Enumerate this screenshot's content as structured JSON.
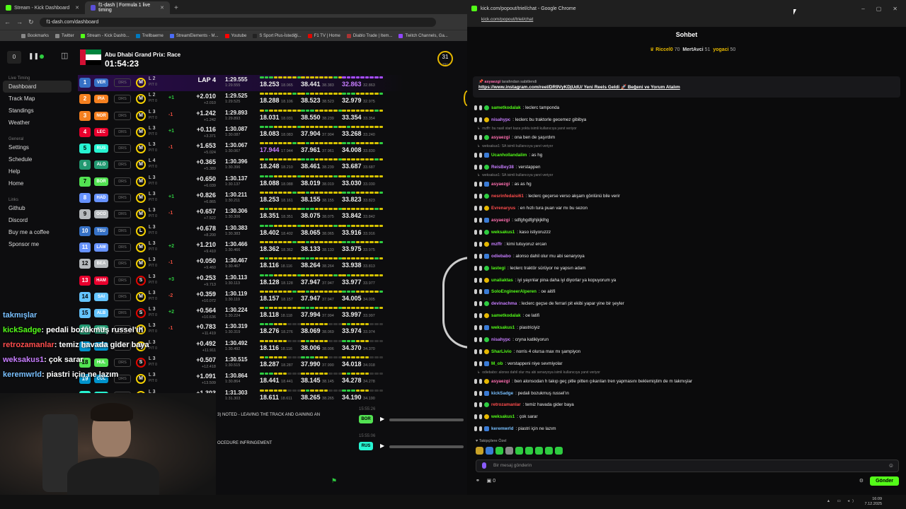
{
  "browser": {
    "tabs": [
      {
        "label": "Stream - Kick Dashboard"
      },
      {
        "label": "f1-dash | Formula 1 live timing"
      }
    ],
    "url": "f1-dash.com/dashboard",
    "bookmarks": [
      "Bookmarks",
      "Twitter",
      "Stream - Kick Dashb...",
      "Trellbaerne",
      "StreamElements - M...",
      "Youtube",
      "S Sport Plus-İstediği...",
      "F1 TV | Home",
      "Diablo Trade | Item...",
      "Twitch Channels, Ga..."
    ]
  },
  "dashboard": {
    "counter": "0",
    "race_title": "Abu Dhabi Grand Prix: Race",
    "race_clock": "01:54:23",
    "temp_value": "31",
    "temp_label": "TRC",
    "sidebar": {
      "section1": "Live Timing",
      "items1": [
        "Dashboard",
        "Track Map",
        "Standings",
        "Weather"
      ],
      "section2": "General",
      "items2": [
        "Settings",
        "Schedule",
        "Help",
        "Home"
      ],
      "section3": "Links",
      "items3": [
        "Github",
        "Discord",
        "Buy me a coffee",
        "Sponsor me"
      ]
    },
    "drs_label": "DRS",
    "rows": [
      {
        "pos": "1",
        "code": "VER",
        "color": "#3671c6",
        "tyre": "M",
        "lap": "L 2",
        "pit": "PIT 0",
        "chg": "",
        "gap": "LAP 4",
        "gap_sub": "",
        "last": "1:29.555",
        "last_sub": "1:29.555",
        "s1": "18.253",
        "s1s": "18.065",
        "s2": "38.441",
        "s2s": "38.383",
        "s3": "32.863",
        "s3s": "32.863"
      },
      {
        "pos": "2",
        "code": "PIA",
        "color": "#f58020",
        "tyre": "M",
        "lap": "L 2",
        "pit": "PIT 0",
        "chg": "+1",
        "gap": "+2.010",
        "gap_sub": "+2.010",
        "last": "1:29.525",
        "last_sub": "1:29.525",
        "s1": "18.288",
        "s1s": "18.106",
        "s2": "38.523",
        "s2s": "38.523",
        "s3": "32.979",
        "s3s": "32.975"
      },
      {
        "pos": "3",
        "code": "NOR",
        "color": "#f58020",
        "tyre": "M",
        "lap": "L 3",
        "pit": "PIT 0",
        "chg": "-1",
        "gap": "+1.242",
        "gap_sub": "+1.242",
        "last": "1:29.893",
        "last_sub": "1:29.893",
        "s1": "18.031",
        "s1s": "18.031",
        "s2": "38.550",
        "s2s": "38.239",
        "s3": "33.354",
        "s3s": "33.354"
      },
      {
        "pos": "4",
        "code": "LEC",
        "color": "#e8002d",
        "tyre": "M",
        "lap": "L 3",
        "pit": "PIT 0",
        "chg": "+1",
        "gap": "+0.116",
        "gap_sub": "+3.371",
        "last": "1:30.087",
        "last_sub": "1:30.087",
        "s1": "18.083",
        "s1s": "18.083",
        "s2": "37.904",
        "s2s": "37.904",
        "s3": "33.268",
        "s3s": "33.240"
      },
      {
        "pos": "5",
        "code": "RUS",
        "color": "#27f4d2",
        "tyre": "M",
        "lap": "L 3",
        "pit": "PIT 0",
        "chg": "-1",
        "gap": "+1.653",
        "gap_sub": "+5.024",
        "last": "1:30.067",
        "last_sub": "1:30.067",
        "s1": "17.944",
        "s1s": "17.944",
        "s2": "37.961",
        "s2s": "37.961",
        "s3": "34.008",
        "s3s": "33.830"
      },
      {
        "pos": "6",
        "code": "ALO",
        "color": "#229971",
        "tyre": "M",
        "lap": "L 4",
        "pit": "PIT 0",
        "chg": "",
        "gap": "+0.365",
        "gap_sub": "+5.389",
        "last": "1:30.396",
        "last_sub": "1:30.396",
        "s1": "18.248",
        "s1s": "18.210",
        "s2": "38.461",
        "s2s": "38.239",
        "s3": "33.687",
        "s3s": "33.687"
      },
      {
        "pos": "7",
        "code": "BOR",
        "color": "#52e252",
        "tyre": "M",
        "lap": "L 3",
        "pit": "PIT 0",
        "chg": "",
        "gap": "+0.650",
        "gap_sub": "+6.039",
        "last": "1:30.137",
        "last_sub": "1:30.137",
        "s1": "18.088",
        "s1s": "18.088",
        "s2": "38.019",
        "s2s": "38.019",
        "s3": "33.030",
        "s3s": "33.030"
      },
      {
        "pos": "8",
        "code": "HAD",
        "color": "#6692ff",
        "tyre": "M",
        "lap": "L 3",
        "pit": "PIT 0",
        "chg": "+1",
        "gap": "+0.826",
        "gap_sub": "+6.865",
        "last": "1:30.211",
        "last_sub": "1:30.211",
        "s1": "18.253",
        "s1s": "18.161",
        "s2": "38.155",
        "s2s": "38.155",
        "s3": "33.823",
        "s3s": "33.823"
      },
      {
        "pos": "9",
        "code": "OCO",
        "color": "#b6babd",
        "tyre": "M",
        "lap": "L 3",
        "pit": "PIT 0",
        "chg": "-1",
        "gap": "+0.657",
        "gap_sub": "+7.522",
        "last": "1:30.306",
        "last_sub": "1:30.306",
        "s1": "18.351",
        "s1s": "18.351",
        "s2": "38.075",
        "s2s": "38.075",
        "s3": "33.842",
        "s3s": "33.842"
      },
      {
        "pos": "10",
        "code": "TSU",
        "color": "#3671c6",
        "tyre": "L",
        "lap": "L 3",
        "pit": "PIT 0",
        "chg": "",
        "gap": "+0.678",
        "gap_sub": "+8.200",
        "last": "1:30.383",
        "last_sub": "1:30.383",
        "s1": "18.402",
        "s1s": "18.402",
        "s2": "38.065",
        "s2s": "38.065",
        "s3": "33.916",
        "s3s": "33.916"
      },
      {
        "pos": "11",
        "code": "LAW",
        "color": "#6692ff",
        "tyre": "M",
        "lap": "L 3",
        "pit": "PIT 0",
        "chg": "+2",
        "gap": "+1.210",
        "gap_sub": "+9.410",
        "last": "1:30.466",
        "last_sub": "1:30.466",
        "s1": "18.362",
        "s1s": "18.362",
        "s2": "38.133",
        "s2s": "38.133",
        "s3": "33.975",
        "s3s": "33.975"
      },
      {
        "pos": "12",
        "code": "BEA",
        "color": "#b6babd",
        "tyre": "M",
        "lap": "L 3",
        "pit": "PIT 0",
        "chg": "-1",
        "gap": "+0.050",
        "gap_sub": "+9.460",
        "last": "1:30.467",
        "last_sub": "1:30.467",
        "s1": "18.116",
        "s1s": "18.116",
        "s2": "38.264",
        "s2s": "38.264",
        "s3": "33.938",
        "s3s": "33.813"
      },
      {
        "pos": "13",
        "code": "HAM",
        "color": "#e8002d",
        "tyre": "S",
        "lap": "L 3",
        "pit": "PIT 0",
        "chg": "+3",
        "gap": "+0.253",
        "gap_sub": "+9.713",
        "last": "1:30.113",
        "last_sub": "1:30.113",
        "s1": "18.128",
        "s1s": "18.128",
        "s2": "37.947",
        "s2s": "37.947",
        "s3": "33.977",
        "s3s": "33.977"
      },
      {
        "pos": "14",
        "code": "SAI",
        "color": "#64c4ff",
        "tyre": "M",
        "lap": "L 3",
        "pit": "PIT 0",
        "chg": "-2",
        "gap": "+0.359",
        "gap_sub": "+10.072",
        "last": "1:30.119",
        "last_sub": "1:30.119",
        "s1": "18.157",
        "s1s": "18.157",
        "s2": "37.947",
        "s2s": "37.947",
        "s3": "34.005",
        "s3s": "34.005"
      },
      {
        "pos": "15",
        "code": "ALB",
        "color": "#64c4ff",
        "tyre": "S",
        "lap": "L 3",
        "pit": "PIT 0",
        "chg": "+2",
        "gap": "+0.564",
        "gap_sub": "+10.636",
        "last": "1:30.224",
        "last_sub": "1:30.224",
        "s1": "18.118",
        "s1s": "18.118",
        "s2": "37.994",
        "s2s": "37.994",
        "s3": "33.997",
        "s3s": "33.997"
      },
      {
        "pos": "16",
        "code": "STR",
        "color": "#229971",
        "tyre": "M",
        "lap": "L 3",
        "pit": "PIT 0",
        "chg": "-1",
        "gap": "+0.783",
        "gap_sub": "+11.419",
        "last": "1:30.319",
        "last_sub": "1:30.319",
        "s1": "18.276",
        "s1s": "18.276",
        "s2": "38.069",
        "s2s": "38.069",
        "s3": "33.974",
        "s3s": "33.974"
      },
      {
        "pos": "17",
        "code": "GAS",
        "color": "#0093cc",
        "tyre": "M",
        "lap": "L 3",
        "pit": "PIT 0",
        "chg": "",
        "gap": "+0.492",
        "gap_sub": "+11.911",
        "last": "1:30.492",
        "last_sub": "1:30.492",
        "s1": "18.116",
        "s1s": "18.116",
        "s2": "38.006",
        "s2s": "38.006",
        "s3": "34.370",
        "s3s": "34.370"
      },
      {
        "pos": "18",
        "code": "HUL",
        "color": "#52e252",
        "tyre": "S",
        "lap": "L 3",
        "pit": "PIT 0",
        "chg": "",
        "gap": "+0.507",
        "gap_sub": "+12.418",
        "last": "1:30.515",
        "last_sub": "1:30.515",
        "s1": "18.287",
        "s1s": "18.287",
        "s2": "37.990",
        "s2s": "37.990",
        "s3": "34.018",
        "s3s": "34.018"
      },
      {
        "pos": "19",
        "code": "COL",
        "color": "#0093cc",
        "tyre": "M",
        "lap": "L 3",
        "pit": "PIT 0",
        "chg": "",
        "gap": "+1.091",
        "gap_sub": "+13.509",
        "last": "1:30.864",
        "last_sub": "1:30.864",
        "s1": "18.441",
        "s1s": "18.441",
        "s2": "38.145",
        "s2s": "38.145",
        "s3": "34.278",
        "s3s": "34.278"
      },
      {
        "pos": "20",
        "code": "ANT",
        "color": "#27f4d2",
        "tyre": "M",
        "lap": "L 3",
        "pit": "PIT 0",
        "chg": "",
        "gap": "+1.303",
        "gap_sub": "+14.812",
        "last": "1:31.303",
        "last_sub": "1:31.303",
        "s1": "18.611",
        "s1s": "18.611",
        "s2": "38.265",
        "s2s": "38.265",
        "s3": "34.190",
        "s3s": "34.190"
      }
    ],
    "stream_overlay": [
      {
        "user": "takmışlar",
        "text": ""
      },
      {
        "user": "kickSadge",
        "text": ": pedali bozukmuş russel'ın"
      },
      {
        "user": "retrozamanlar",
        "text": ": temiz havada gider baya"
      },
      {
        "user": "weksakus1",
        "text": ": çok sarar"
      },
      {
        "user": "keremwrld",
        "text": ": piastri için ne lazım"
      }
    ],
    "race_control": {
      "msg1": "3) NOTED - LEAVING THE TRACK AND GAINING AN",
      "msg2": "OCEDURE INFRINGEMENT",
      "radio1_time": "15:55:26",
      "radio1_team": "BOR",
      "radio2_time": "15:55:06",
      "radio2_team": "RUS"
    }
  },
  "chat": {
    "window_title": "kick.com/popout/triel/chat - Google Chrome",
    "url": "kick.com/popout/triel/chat",
    "heading": "Sohbet",
    "top_gifters": [
      {
        "name": "Riccel0",
        "count": "70"
      },
      {
        "name": "MertAvci",
        "count": "51"
      },
      {
        "name": "yogaci",
        "count": "50"
      }
    ],
    "pinned_by": "asyaezgi",
    "pinned_label": "tarafından sabitlendi",
    "pinned_text": "https://www.instagram.com/reel/DR9VyKDjUdU/ Yeni Reels Geldi 🚀 Beğeni ve Yorum Atalım",
    "messages": [
      {
        "user": "sametkodalak",
        "color": "#53fc18",
        "text": ": leclerc tamponda"
      },
      {
        "user": "nisahypc",
        "color": "#c77dff",
        "text": ": leclerc bu traktorle gecemez gibibya"
      },
      {
        "reply": "mzffr: bu nasil start kaza yoktu isimli kullanıcıya yanıt veriyor"
      },
      {
        "user": "asyaezgi",
        "color": "#ff6fb0",
        "text": ": ona ben de şaşırdım"
      },
      {
        "reply": "weksakus1: SA isimli kullanıcıya yanıt veriyor"
      },
      {
        "user": "Ucanhollandalim",
        "color": "#53fc18",
        "text": ": as hg"
      },
      {
        "user": "ReisBey38",
        "color": "#c77dff",
        "text": ": verstappen"
      },
      {
        "reply": "weksakus1: SA isimli kullanıcıya yanıt veriyor"
      },
      {
        "user": "asyaezgi",
        "color": "#ff6fb0",
        "text": ": as as hg"
      },
      {
        "user": "nesrinfedaisi61",
        "color": "#ff4d4d",
        "text": ": leclerc geçerse verso akşam gönlünü bile verir"
      },
      {
        "user": "Evrenaryus",
        "color": "#ff4d4d",
        "text": ": en hızlı tura puan var mı bu sezon"
      },
      {
        "user": "asyaezgi",
        "color": "#ff6fb0",
        "text": ": sdfghgdfghjkjklhg"
      },
      {
        "user": "weksakus1",
        "color": "#53fc18",
        "text": ": kaso istiyoruzzz"
      },
      {
        "user": "mzffr",
        "color": "#c77dff",
        "text": ": kimi tutuyoruz ercan"
      },
      {
        "user": "odiebabo",
        "color": "#c77dff",
        "text": ": alonso dahil olur mu abi senaryoya"
      },
      {
        "user": "lastegi",
        "color": "#53fc18",
        "text": ": leclerc traktör sürüyor ne yapsın adam"
      },
      {
        "user": "unaliaktas",
        "color": "#53fc18",
        "text": ": iyi yayınlar pina daha iyi diyorlar ya kopuyorum ya"
      },
      {
        "user": "SoloEngineerAlperen",
        "color": "#53fc18",
        "text": ": oe aitifi"
      },
      {
        "user": "devinachma",
        "color": "#c77dff",
        "text": ": leclerc geçse de ferrari pit ekibi yapar yine bir şeyler"
      },
      {
        "user": "sametkodalak",
        "color": "#53fc18",
        "text": ": oe latifi"
      },
      {
        "user": "weksakus1",
        "color": "#53fc18",
        "text": ": piastriciyiz"
      },
      {
        "user": "nisahypc",
        "color": "#c77dff",
        "text": ": cryna katikiyorun"
      },
      {
        "user": "SharLivio",
        "color": "#53fc18",
        "text": ": norris 4 olursa max mı şampiyon"
      },
      {
        "user": "M_ob",
        "color": "#53fc18",
        "text": ": verstappeni niye sevmiyolar"
      },
      {
        "reply": "odiebabo: alonso dahil olur mu abi senaryoya isimli kullanıcıya yanıt veriyor"
      },
      {
        "user": "asyaezgi",
        "color": "#ff6fb0",
        "text": ": ben alonsodan h takıp geç pitle pitten çıkarılan tren yapmasını beklemiştim de m takmışlar"
      },
      {
        "user": "kickSadge",
        "color": "#79c0ff",
        "text": ": pedali bozukmuş russel'ın"
      },
      {
        "user": "retrozamanlar",
        "color": "#ff4d4d",
        "text": ": temiz havada gider baya"
      },
      {
        "user": "weksakus1",
        "color": "#53fc18",
        "text": ": çok sarar"
      },
      {
        "user": "keremwrld",
        "color": "#79c0ff",
        "text": ": piastri için ne lazım"
      }
    ],
    "sub_note": "♥ Takipçilere Özel",
    "input_placeholder": "Bir mesaj gönderin",
    "points": "0",
    "send_label": "Gönder"
  },
  "taskbar": {
    "time": "16:09",
    "date": "7.12.2025"
  }
}
